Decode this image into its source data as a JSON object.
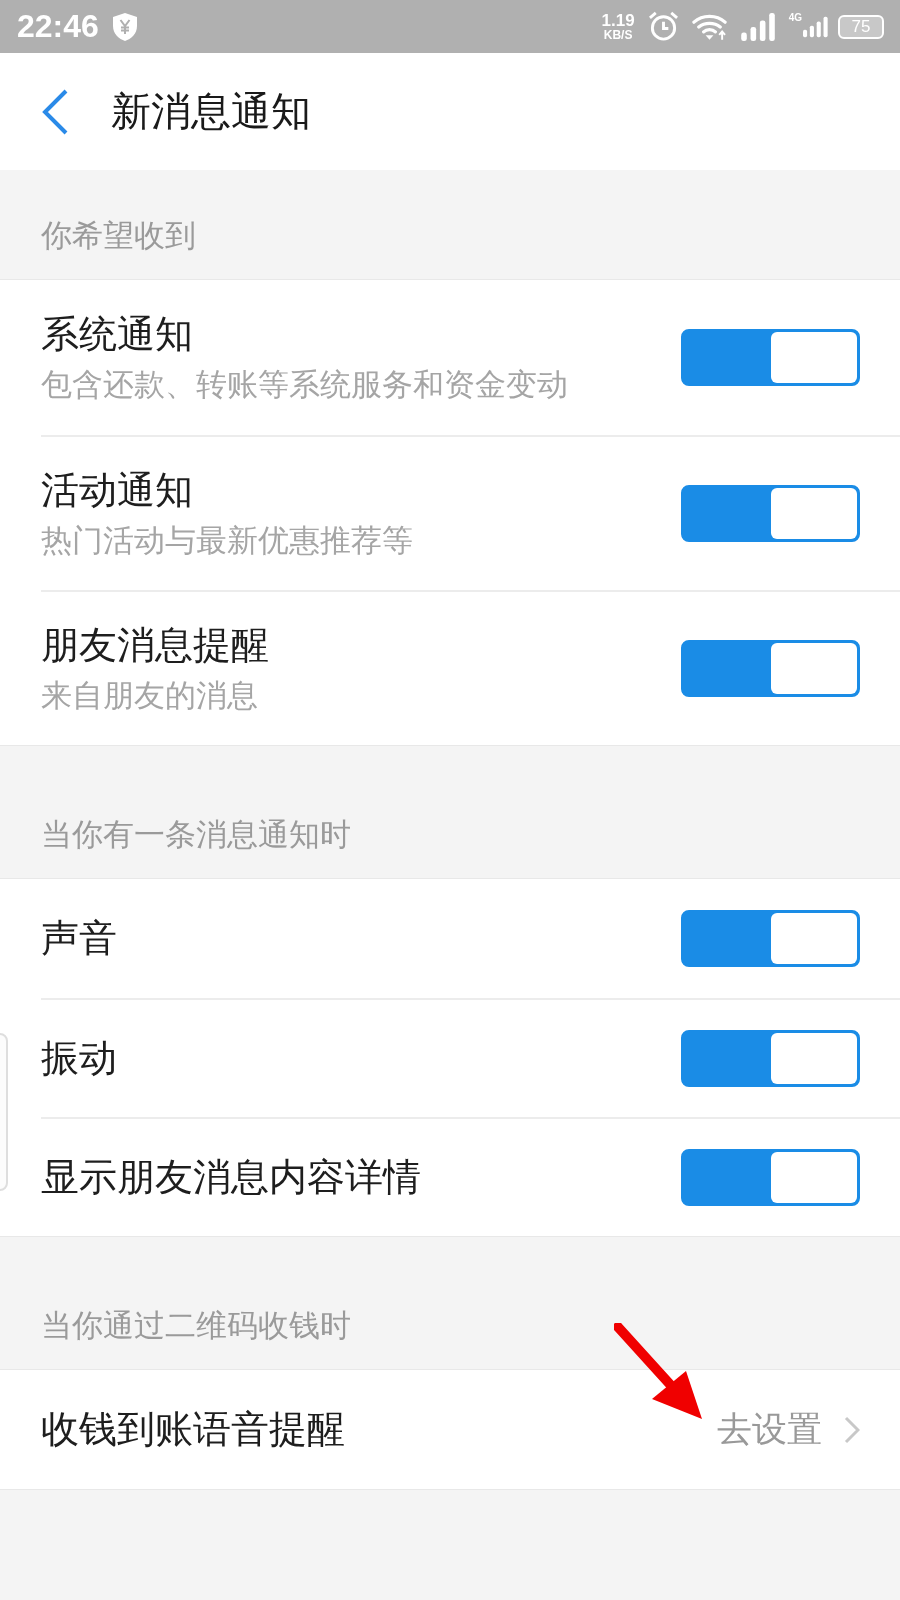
{
  "status_bar": {
    "time": "22:46",
    "speed_value": "1.19",
    "speed_unit": "KB/S",
    "network_type": "4G",
    "battery": "75"
  },
  "header": {
    "title": "新消息通知"
  },
  "sections": [
    {
      "label": "你希望收到",
      "rows": [
        {
          "kind": "toggle",
          "title": "系统通知",
          "subtitle": "包含还款、转账等系统服务和资金变动",
          "on": true
        },
        {
          "kind": "toggle",
          "title": "活动通知",
          "subtitle": "热门活动与最新优惠推荐等",
          "on": true
        },
        {
          "kind": "toggle",
          "title": "朋友消息提醒",
          "subtitle": "来自朋友的消息",
          "on": true
        }
      ]
    },
    {
      "label": "当你有一条消息通知时",
      "rows": [
        {
          "kind": "toggle",
          "title": "声音",
          "on": true
        },
        {
          "kind": "toggle",
          "title": "振动",
          "on": true
        },
        {
          "kind": "toggle",
          "title": "显示朋友消息内容详情",
          "on": true
        }
      ]
    },
    {
      "label": "当你通过二维码收钱时",
      "rows": [
        {
          "kind": "link",
          "title": "收钱到账语音提醒",
          "action": "去设置"
        }
      ]
    }
  ]
}
